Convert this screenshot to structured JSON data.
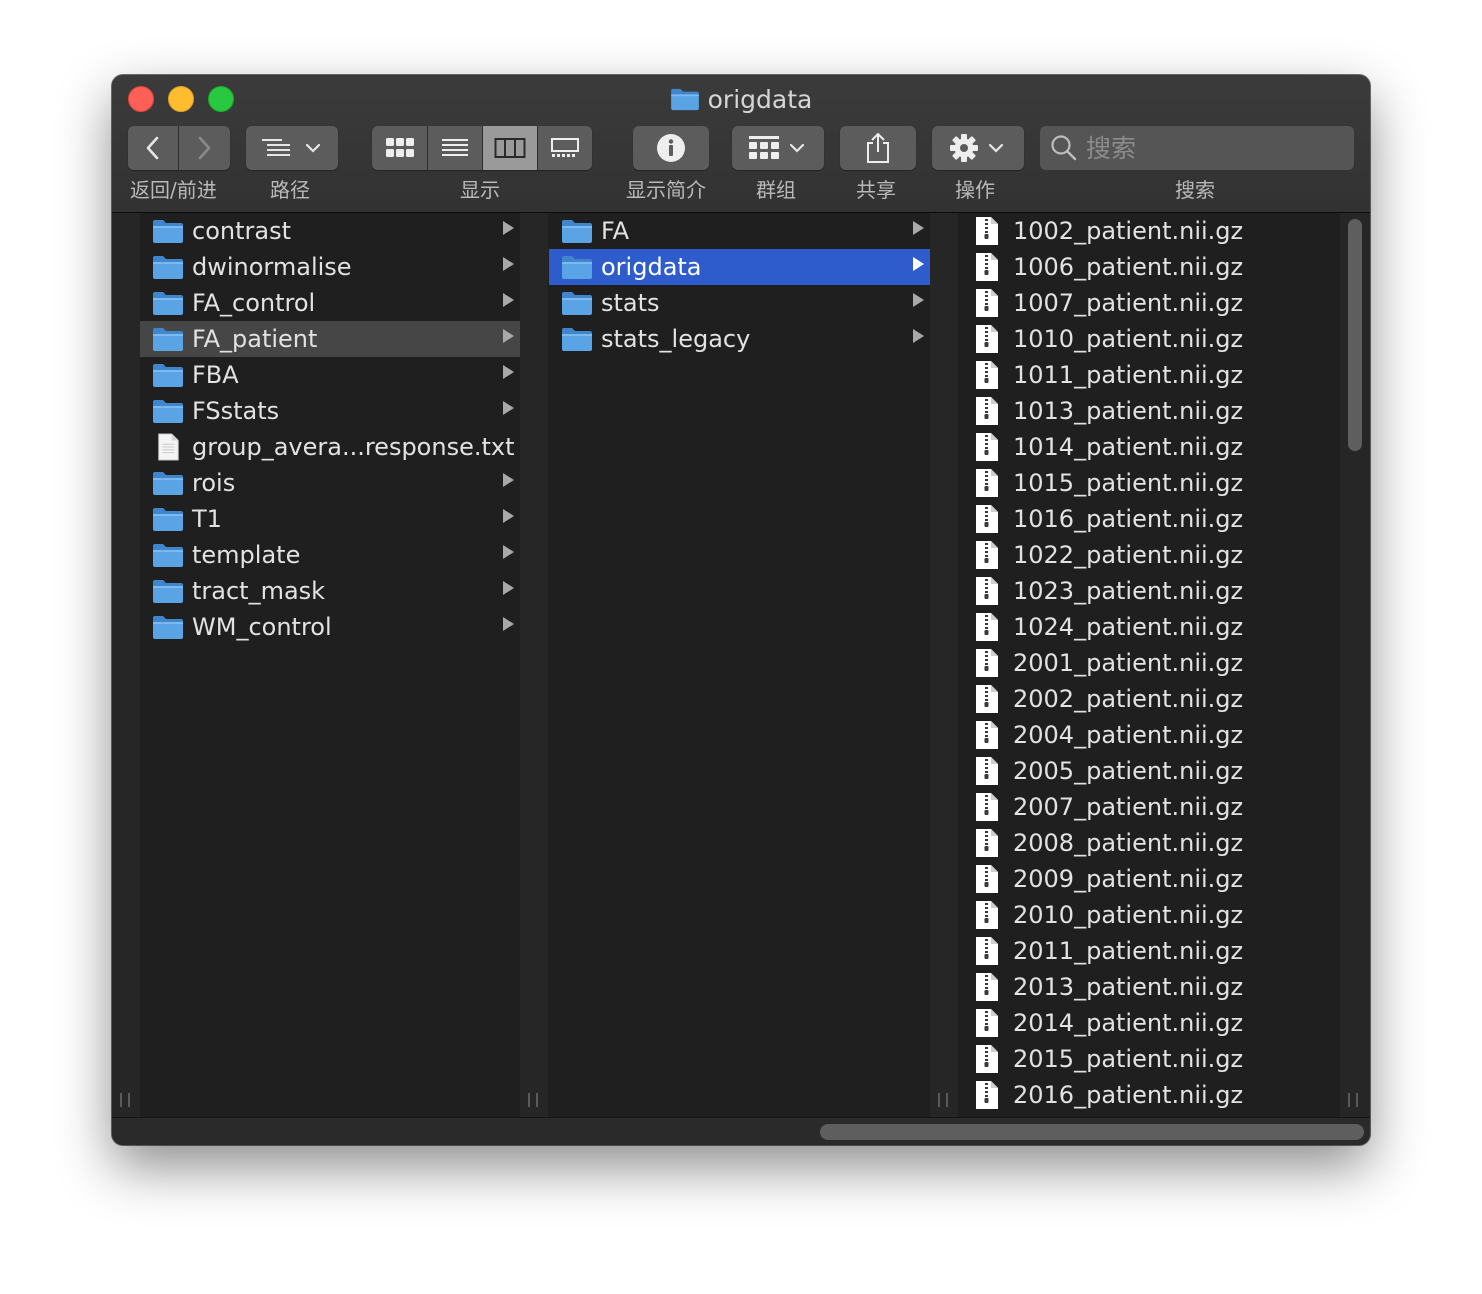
{
  "window": {
    "title": "origdata",
    "colors": {
      "selection": "#2f5ccc",
      "folder": "#5aa4e6"
    }
  },
  "toolbar": {
    "back_forward_label": "返回/前进",
    "path_label": "路径",
    "view_label": "显示",
    "info_label": "显示简介",
    "group_label": "群组",
    "share_label": "共享",
    "action_label": "操作",
    "search_label": "搜索",
    "search_placeholder": "搜索",
    "view_modes": [
      "icon-view-icon",
      "list-view-icon",
      "column-view-icon",
      "gallery-view-icon"
    ],
    "active_view": "column-view-icon"
  },
  "columns": {
    "first": [
      {
        "name": "contrast",
        "kind": "folder"
      },
      {
        "name": "dwinormalise",
        "kind": "folder"
      },
      {
        "name": "FA_control",
        "kind": "folder"
      },
      {
        "name": "FA_patient",
        "kind": "folder",
        "selected": "inactive"
      },
      {
        "name": "FBA",
        "kind": "folder"
      },
      {
        "name": "FSstats",
        "kind": "folder"
      },
      {
        "name": "group_avera...response.txt",
        "kind": "file"
      },
      {
        "name": "rois",
        "kind": "folder"
      },
      {
        "name": "T1",
        "kind": "folder"
      },
      {
        "name": "template",
        "kind": "folder"
      },
      {
        "name": "tract_mask",
        "kind": "folder"
      },
      {
        "name": "WM_control",
        "kind": "folder"
      }
    ],
    "second": [
      {
        "name": "FA",
        "kind": "folder"
      },
      {
        "name": "origdata",
        "kind": "folder",
        "selected": "active"
      },
      {
        "name": "stats",
        "kind": "folder"
      },
      {
        "name": "stats_legacy",
        "kind": "folder"
      }
    ],
    "third": [
      "1002_patient.nii.gz",
      "1006_patient.nii.gz",
      "1007_patient.nii.gz",
      "1010_patient.nii.gz",
      "1011_patient.nii.gz",
      "1013_patient.nii.gz",
      "1014_patient.nii.gz",
      "1015_patient.nii.gz",
      "1016_patient.nii.gz",
      "1022_patient.nii.gz",
      "1023_patient.nii.gz",
      "1024_patient.nii.gz",
      "2001_patient.nii.gz",
      "2002_patient.nii.gz",
      "2004_patient.nii.gz",
      "2005_patient.nii.gz",
      "2007_patient.nii.gz",
      "2008_patient.nii.gz",
      "2009_patient.nii.gz",
      "2010_patient.nii.gz",
      "2011_patient.nii.gz",
      "2013_patient.nii.gz",
      "2014_patient.nii.gz",
      "2015_patient.nii.gz",
      "2016_patient.nii.gz"
    ]
  }
}
